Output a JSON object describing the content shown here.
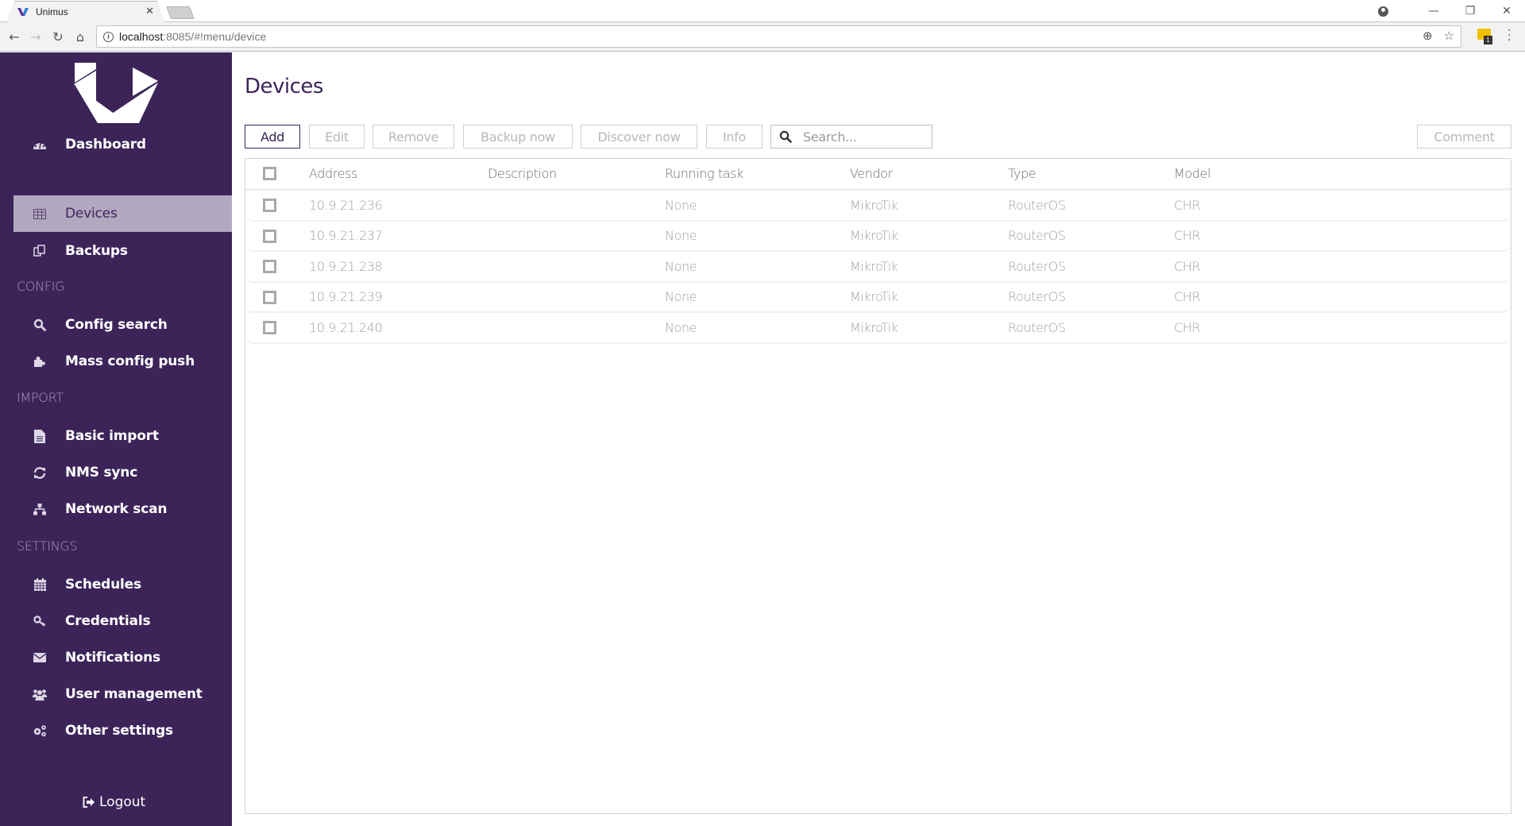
{
  "browser": {
    "tab_title": "Unimus",
    "url_host": "localhost",
    "url_rest": ":8085/#!menu/device",
    "extension_badge": "1"
  },
  "sidebar": {
    "nav_top": [
      {
        "label": "Dashboard",
        "icon": "dashboard-icon"
      },
      {
        "label": "Devices",
        "icon": "table-icon",
        "active": true
      },
      {
        "label": "Backups",
        "icon": "copy-icon"
      }
    ],
    "sections": [
      {
        "title": "CONFIG",
        "items": [
          {
            "label": "Config search",
            "icon": "search-icon"
          },
          {
            "label": "Mass config push",
            "icon": "puzzle-icon"
          }
        ]
      },
      {
        "title": "IMPORT",
        "items": [
          {
            "label": "Basic import",
            "icon": "file-icon"
          },
          {
            "label": "NMS sync",
            "icon": "refresh-icon"
          },
          {
            "label": "Network scan",
            "icon": "sitemap-icon"
          }
        ]
      },
      {
        "title": "SETTINGS",
        "items": [
          {
            "label": "Schedules",
            "icon": "calendar-icon"
          },
          {
            "label": "Credentials",
            "icon": "key-icon"
          },
          {
            "label": "Notifications",
            "icon": "envelope-icon"
          },
          {
            "label": "User management",
            "icon": "users-icon"
          },
          {
            "label": "Other settings",
            "icon": "cogs-icon"
          }
        ]
      }
    ],
    "logout_label": "Logout"
  },
  "main": {
    "title": "Devices",
    "toolbar": {
      "add": "Add",
      "edit": "Edit",
      "remove": "Remove",
      "backup_now": "Backup now",
      "discover_now": "Discover now",
      "info": "Info",
      "search_placeholder": "Search...",
      "comment": "Comment"
    },
    "table": {
      "columns": [
        "Address",
        "Description",
        "Running task",
        "Vendor",
        "Type",
        "Model"
      ],
      "rows": [
        {
          "address": "10.9.21.236",
          "description": "",
          "running_task": "None",
          "vendor": "MikroTik",
          "type": "RouterOS",
          "model": "CHR"
        },
        {
          "address": "10.9.21.237",
          "description": "",
          "running_task": "None",
          "vendor": "MikroTik",
          "type": "RouterOS",
          "model": "CHR"
        },
        {
          "address": "10.9.21.238",
          "description": "",
          "running_task": "None",
          "vendor": "MikroTik",
          "type": "RouterOS",
          "model": "CHR"
        },
        {
          "address": "10.9.21.239",
          "description": "",
          "running_task": "None",
          "vendor": "MikroTik",
          "type": "RouterOS",
          "model": "CHR"
        },
        {
          "address": "10.9.21.240",
          "description": "",
          "running_task": "None",
          "vendor": "MikroTik",
          "type": "RouterOS",
          "model": "CHR"
        }
      ]
    }
  },
  "colors": {
    "sidebar_bg": "#3c2459",
    "sidebar_active_bg": "#b2a8c0",
    "accent": "#3c2459"
  }
}
